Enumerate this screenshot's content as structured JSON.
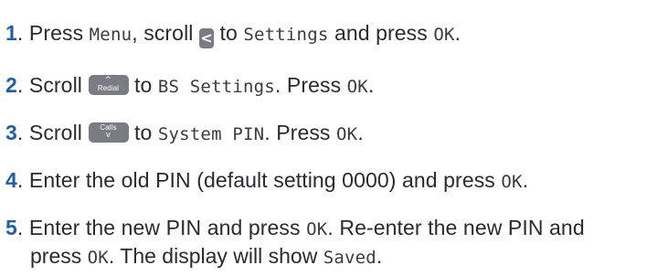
{
  "steps": [
    {
      "number": "1",
      "t1": ". Press ",
      "lcd1": "Menu",
      "t2": ", scroll ",
      "key": "<",
      "t3": " to ",
      "lcd2": "Settings",
      "t4": " and press ",
      "lcd3": "OK",
      "t5": "."
    },
    {
      "number": "2",
      "t1": ". Scroll ",
      "key_symbol": "^",
      "key_label": "Redial",
      "t2": " to ",
      "lcd1": "BS Settings",
      "t3": ". Press ",
      "lcd2": "OK",
      "t4": "."
    },
    {
      "number": "3",
      "t1": ". Scroll ",
      "key_label": "Calls",
      "key_symbol": "v",
      "t2": " to ",
      "lcd1": "System PIN",
      "t3": ". Press ",
      "lcd2": "OK",
      "t4": "."
    },
    {
      "number": "4",
      "t1": ". Enter the old PIN (default setting 0000) and press ",
      "lcd1": "OK",
      "t2": "."
    },
    {
      "number": "5",
      "t1": ". Enter the new PIN and press ",
      "lcd1": "OK",
      "t2": ". Re-enter the new PIN and",
      "c1": "press ",
      "lcd2": "OK",
      "c2": ". The display will show ",
      "lcd3": "Saved",
      "c3": "."
    }
  ],
  "colors": {
    "step_number": "#1f5fa8",
    "body_text": "#2a2a35",
    "key_background": "#7b7b84"
  }
}
